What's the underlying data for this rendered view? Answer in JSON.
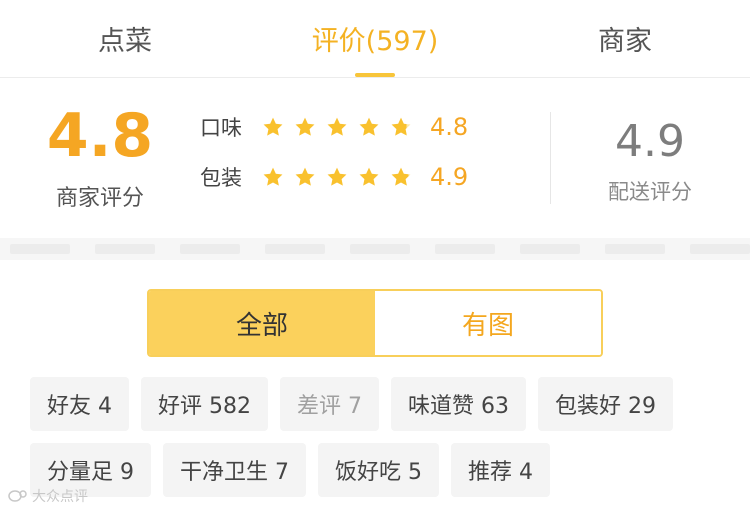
{
  "tabs": [
    {
      "label": "点菜",
      "active": false
    },
    {
      "label": "评价(597)",
      "active": true
    },
    {
      "label": "商家",
      "active": false
    }
  ],
  "summary": {
    "merchant_score": "4.8",
    "merchant_label": "商家评分",
    "rows": [
      {
        "name": "口味",
        "value": "4.8",
        "stars": 4.8
      },
      {
        "name": "包装",
        "value": "4.9",
        "stars": 4.9
      }
    ],
    "delivery_score": "4.9",
    "delivery_label": "配送评分"
  },
  "filter": {
    "all_label": "全部",
    "with_pics_label": "有图",
    "selected": "全部"
  },
  "tags": [
    [
      {
        "label": "好友 4"
      },
      {
        "label": "好评 582"
      },
      {
        "label": "差评 7",
        "muted": true
      },
      {
        "label": "味道赞 63"
      },
      {
        "label": "包装好 29"
      }
    ],
    [
      {
        "label": "分量足 9"
      },
      {
        "label": "干净卫生 7"
      },
      {
        "label": "饭好吃 5"
      },
      {
        "label": "推荐 4"
      }
    ]
  ],
  "watermark": "大众点评",
  "colors": {
    "accent": "#f5a623",
    "tab_active": "#f4b223",
    "segment_fill": "#fbd15c",
    "chip_bg": "#f4f4f4"
  }
}
